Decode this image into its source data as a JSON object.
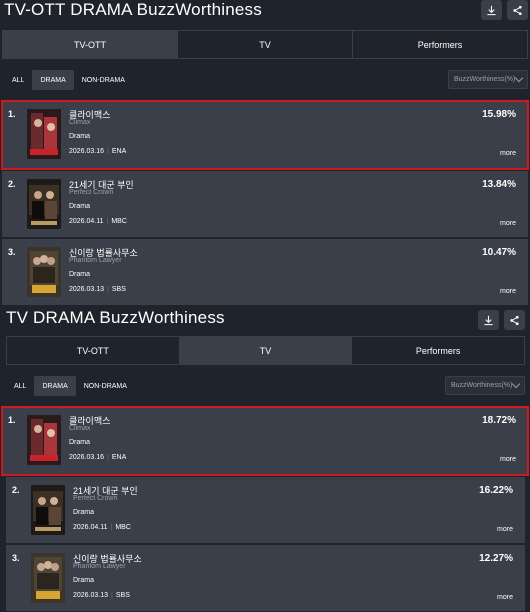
{
  "sections": [
    {
      "title": "TV-OTT DRAMA BuzzWorthiness",
      "tabs": [
        "TV-OTT",
        "TV",
        "Performers"
      ],
      "active_tab": 0,
      "filters": [
        "ALL",
        "DRAMA",
        "NON-DRAMA"
      ],
      "active_filter": 1,
      "dropdown": "BuzzWorthiness(%)",
      "rows": [
        {
          "rank": "1.",
          "name_kr": "클라이맥스",
          "name_en": "Climax",
          "genre": "Drama",
          "date": "2026.03.16",
          "channel": "ENA",
          "pct": "15.98%",
          "more": "more"
        },
        {
          "rank": "2.",
          "name_kr": "21세기 대군 부인",
          "name_en": "Perfect Crown",
          "genre": "Drama",
          "date": "2026.04.11",
          "channel": "MBC",
          "pct": "13.84%",
          "more": "more"
        },
        {
          "rank": "3.",
          "name_kr": "신이랑 법률사무소",
          "name_en": "Phantom Lawyer",
          "genre": "Drama",
          "date": "2026.03.13",
          "channel": "SBS",
          "pct": "10.47%",
          "more": "more"
        }
      ]
    },
    {
      "title": "TV DRAMA BuzzWorthiness",
      "tabs": [
        "TV-OTT",
        "TV",
        "Performers"
      ],
      "active_tab": 1,
      "filters": [
        "ALL",
        "DRAMA",
        "NON-DRAMA"
      ],
      "active_filter": 1,
      "dropdown": "BuzzWorthiness(%)",
      "rows": [
        {
          "rank": "1.",
          "name_kr": "클라이맥스",
          "name_en": "Climax",
          "genre": "Drama",
          "date": "2026.03.16",
          "channel": "ENA",
          "pct": "18.72%",
          "more": "more"
        },
        {
          "rank": "2.",
          "name_kr": "21세기 대군 부인",
          "name_en": "Perfect Crown",
          "genre": "Drama",
          "date": "2026.04.11",
          "channel": "MBC",
          "pct": "16.22%",
          "more": "more"
        },
        {
          "rank": "3.",
          "name_kr": "신이랑 법률사무소",
          "name_en": "Phantom Lawyer",
          "genre": "Drama",
          "date": "2026.03.13",
          "channel": "SBS",
          "pct": "12.27%",
          "more": "more"
        }
      ]
    }
  ],
  "icons": {
    "download": "download-icon",
    "share": "share-icon"
  },
  "colors": {
    "background": "#1f232b",
    "panel": "#3a3f49",
    "highlight": "#d0191f",
    "muted": "#9aa0aa"
  }
}
